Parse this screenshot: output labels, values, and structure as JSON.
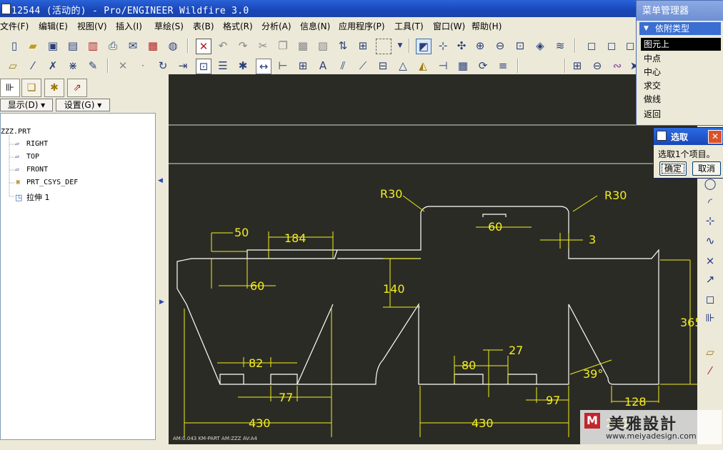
{
  "window": {
    "title": "12544 (活动的) - Pro/ENGINEER Wildfire 3.0"
  },
  "menu": [
    "文件(F)",
    "编辑(E)",
    "视图(V)",
    "插入(I)",
    "草绘(S)",
    "表(B)",
    "格式(R)",
    "分析(A)",
    "信息(N)",
    "应用程序(P)",
    "工具(T)",
    "窗口(W)",
    "帮助(H)"
  ],
  "toolbar": {
    "spin_value": "0"
  },
  "navigator": {
    "show_label": "显示(D) ▾",
    "settings_label": "设置(G) ▾",
    "items": [
      "ZZZ.PRT",
      "RIGHT",
      "TOP",
      "FRONT",
      "PRT_CSYS_DEF",
      "拉伸 1"
    ]
  },
  "menu_manager": {
    "title": "菜单管理器",
    "section": "依附类型",
    "items": [
      "图元上",
      "中点",
      "中心",
      "求交",
      "做线",
      "返回"
    ],
    "selected": 0
  },
  "select_dialog": {
    "title": "选取",
    "message": "选取1个项目。",
    "ok": "确定",
    "cancel": "取消"
  },
  "dimensions": {
    "r_left": "R30",
    "r_right": "R30",
    "d50": "50",
    "d184": "184",
    "d60a": "60",
    "d60b": "60",
    "d3": "3",
    "d140": "140",
    "d365": "365",
    "d82": "82",
    "d77": "77",
    "d80": "80",
    "d27": "27",
    "d39": "39°",
    "d97": "97",
    "d128": "128",
    "d430a": "430",
    "d430b": "430",
    "d260": "260"
  },
  "canvas_status": "AM:0.043  KM-PART  AM:ZZZ  AV:A4",
  "watermark": {
    "logo": "美雅設計",
    "url": "www.meiyadesign.com"
  }
}
